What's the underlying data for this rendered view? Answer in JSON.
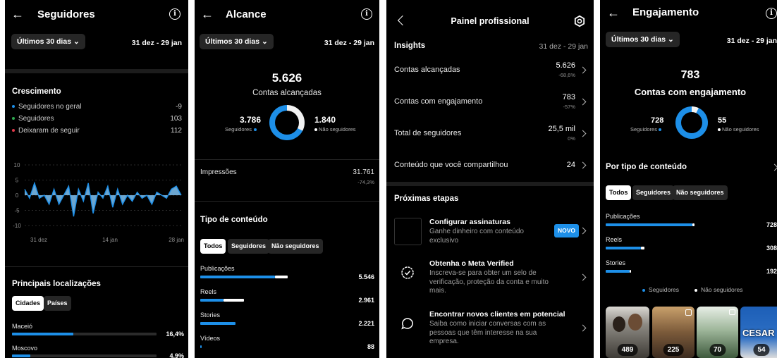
{
  "followers": {
    "title": "Seguidores",
    "period": "Últimos 30 dias",
    "date_range": "31 dez - 29 jan",
    "growth_title": "Crescimento",
    "stats": [
      {
        "label": "Seguidores no geral",
        "value": "-9",
        "color": "#1d8fe8"
      },
      {
        "label": "Seguidores",
        "value": "103",
        "color": "#2ea84f"
      },
      {
        "label": "Deixaram de seguir",
        "value": "112",
        "color": "#e0394a"
      }
    ],
    "chart_data": {
      "type": "area",
      "x_tick_labels": [
        "31 dez",
        "14 jan",
        "28 jan"
      ],
      "y_ticks": [
        "10",
        "5",
        "0",
        "-5",
        "-10"
      ],
      "ylim": [
        -10,
        10
      ],
      "grid": true,
      "series": [
        {
          "values": [
            2,
            -1,
            4,
            -1,
            0,
            -3,
            2,
            -3,
            0,
            3,
            -7,
            2,
            -2,
            4,
            -6,
            1,
            -1,
            3,
            -4,
            2,
            -3,
            0,
            -2,
            1,
            -1,
            0,
            -3,
            1,
            0,
            -1,
            2,
            3,
            0
          ]
        }
      ]
    },
    "locations_title": "Principais localizações",
    "tabs": [
      "Cidades",
      "Países"
    ],
    "locations": [
      {
        "name": "Maceió",
        "value": "16,4%",
        "fraction": 0.164
      },
      {
        "name": "Moscovo",
        "value": "4,9%",
        "fraction": 0.049
      }
    ]
  },
  "reach": {
    "title": "Alcance",
    "period": "Últimos 30 dias",
    "date_range": "31 dez - 29 jan",
    "total": "5.626",
    "total_label": "Contas alcançadas",
    "followers_value": "3.786",
    "followers_label": "Seguidores",
    "non_followers_value": "1.840",
    "non_followers_label": "Não seguidores",
    "impressions_label": "Impressões",
    "impressions_value": "31.761",
    "impressions_change": "-74,3%",
    "content_title": "Tipo de conteúdo",
    "tabs": [
      "Todos",
      "Seguidores",
      "Não seguidores"
    ],
    "content": [
      {
        "label": "Publicações",
        "value": "5.546",
        "followers_fraction": 0.7,
        "non_followers_fraction": 0.12
      },
      {
        "label": "Reels",
        "value": "2.961",
        "followers_fraction": 0.22,
        "non_followers_fraction": 0.19
      },
      {
        "label": "Stories",
        "value": "2.221",
        "followers_fraction": 0.33,
        "non_followers_fraction": 0.0
      },
      {
        "label": "Vídeos",
        "value": "88",
        "followers_fraction": 0.01,
        "non_followers_fraction": 0.0
      }
    ]
  },
  "dashboard": {
    "title": "Painel profissional",
    "insights_title": "Insights",
    "date_range": "31 dez - 29 jan",
    "rows": [
      {
        "label": "Contas alcançadas",
        "value": "5.626",
        "change": "-68,6%"
      },
      {
        "label": "Contas com engajamento",
        "value": "783",
        "change": "-57%"
      },
      {
        "label": "Total de seguidores",
        "value": "25,5 mil",
        "change": "0%"
      },
      {
        "label": "Conteúdo que você compartilhou",
        "value": "24",
        "change": ""
      }
    ],
    "next_title": "Próximas etapas",
    "steps": [
      {
        "title": "Configurar assinaturas",
        "desc": "Ganhe dinheiro com conteúdo exclusivo",
        "badge": "NOVO",
        "icon": "subscriptions-icon"
      },
      {
        "title": "Obtenha o Meta Verified",
        "desc": "Inscreva-se para obter um selo de verificação, proteção da conta e muito mais.",
        "badge": "",
        "icon": "verified-badge-icon"
      },
      {
        "title": "Encontrar novos clientes em potencial",
        "desc": "Saiba como iniciar conversas com as pessoas que têm interesse na sua empresa.",
        "badge": "",
        "icon": "chat-bubble-icon"
      }
    ]
  },
  "engagement": {
    "title": "Engajamento",
    "period": "Últimos 30 dias",
    "date_range": "31 dez - 29 jan",
    "total": "783",
    "total_label": "Contas com engajamento",
    "followers_value": "728",
    "followers_label": "Seguidores",
    "non_followers_value": "55",
    "non_followers_label": "Não seguidores",
    "content_title": "Por tipo de conteúdo",
    "tabs": [
      "Todos",
      "Seguidores",
      "Não seguidores"
    ],
    "content": [
      {
        "label": "Publicações",
        "value": "728",
        "followers_fraction": 0.98,
        "non_followers_fraction": 0.02
      },
      {
        "label": "Reels",
        "value": "308",
        "followers_fraction": 0.4,
        "non_followers_fraction": 0.04
      },
      {
        "label": "Stories",
        "value": "192",
        "followers_fraction": 0.27,
        "non_followers_fraction": 0.01
      }
    ],
    "legend": [
      "Seguidores",
      "Não seguidores"
    ],
    "posts": [
      {
        "count": "489",
        "bg": "#6d6a5e"
      },
      {
        "count": "225",
        "bg": "#8a6b48"
      },
      {
        "count": "70",
        "bg": "#5d7f5a"
      },
      {
        "count": "54",
        "bg": "#2d5fa8"
      }
    ],
    "thumb_text": "CESAR"
  },
  "colors": {
    "accent": "#1d8fe8",
    "background": "#000000",
    "separator": "#262626"
  }
}
